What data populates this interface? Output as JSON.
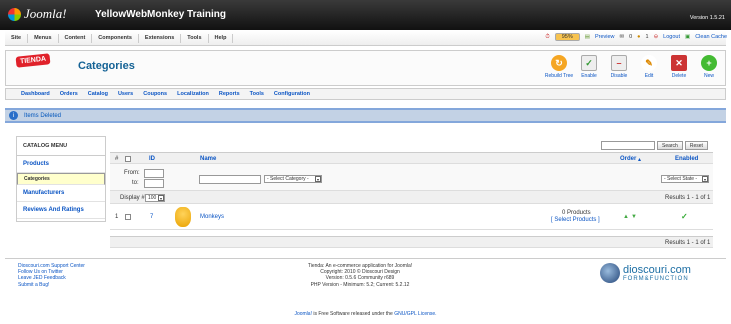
{
  "header": {
    "logo_text": "Joomla!",
    "site_title": "YellowWebMonkey Training",
    "version": "Version 1.5.21"
  },
  "menu": [
    "Site",
    "Menus",
    "Content",
    "Components",
    "Extensions",
    "Tools",
    "Help"
  ],
  "status": {
    "percent": "95%",
    "preview": "Preview",
    "messages": "0",
    "users": "1",
    "logout": "Logout",
    "clean_cache": "Clean Cache"
  },
  "toolbar": {
    "brand": "TIENDA",
    "title": "Categories",
    "buttons": [
      "Rebuild Tree",
      "Enable",
      "Disable",
      "Edit",
      "Delete",
      "New"
    ]
  },
  "subnav": [
    "Dashboard",
    "Orders",
    "Catalog",
    "Users",
    "Coupons",
    "Localization",
    "Reports",
    "Tools",
    "Configuration"
  ],
  "message": "Items Deleted",
  "catalog_menu": {
    "title": "CATALOG MENU",
    "items": [
      "Products",
      "Categories",
      "Manufacturers",
      "Reviews And Ratings"
    ],
    "selected": "Categories"
  },
  "search": {
    "button": "Search",
    "reset": "Reset"
  },
  "table": {
    "headers": {
      "num": "#",
      "id": "ID",
      "name": "Name",
      "order": "Order",
      "enabled": "Enabled"
    },
    "filter": {
      "from": "From:",
      "to": "to:",
      "category": "- Select Category -",
      "state": "- Select State -"
    },
    "display_label": "Display #",
    "display_value": "100",
    "results": "Results 1 - 1 of 1",
    "rows": [
      {
        "num": "1",
        "id": "7",
        "name": "Monkeys",
        "products": "0 Products",
        "select_products": "[ Select Products ]"
      }
    ]
  },
  "footer": {
    "links": [
      "Dioscouri.com Support Center",
      "Follow Us on Twitter",
      "Leave JED Feedback",
      "Submit a Bug!"
    ],
    "info": [
      "Tienda: An e-commerce application for Joomla!",
      "Copyright: 2010 © Dioscouri Design",
      "Version: 0.5.6 Community r689",
      "PHP Version - Minimum: 5.2; Current: 5.2.12"
    ],
    "brand_1": "dioscouri.com",
    "brand_2": "FORM&FUNCTION",
    "bottom_a": "Joomla!",
    "bottom_b": " is Free Software released under the ",
    "bottom_c": "GNU/GPL License."
  }
}
